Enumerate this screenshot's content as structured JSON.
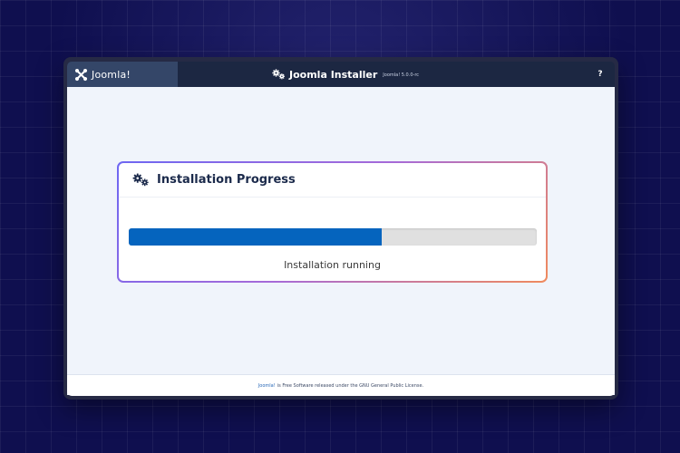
{
  "header": {
    "logo_text": "Joomla!",
    "title": "Joomla Installer",
    "version": "Joomla! 5.0.0-rc",
    "help_label": "?"
  },
  "card": {
    "title": "Installation Progress",
    "progress_percent": 62,
    "status": "Installation running"
  },
  "footer": {
    "link_text": "Joomla!",
    "text": "is Free Software released under the GNU General Public License."
  },
  "colors": {
    "header_bg": "#1c2742",
    "progress_fill": "#0564be",
    "card_border_start": "#6e67f2",
    "card_border_end": "#f08a5d"
  },
  "icons": {
    "logo": "joomla-logo-icon",
    "title": "gears-icon",
    "card": "gears-icon"
  }
}
